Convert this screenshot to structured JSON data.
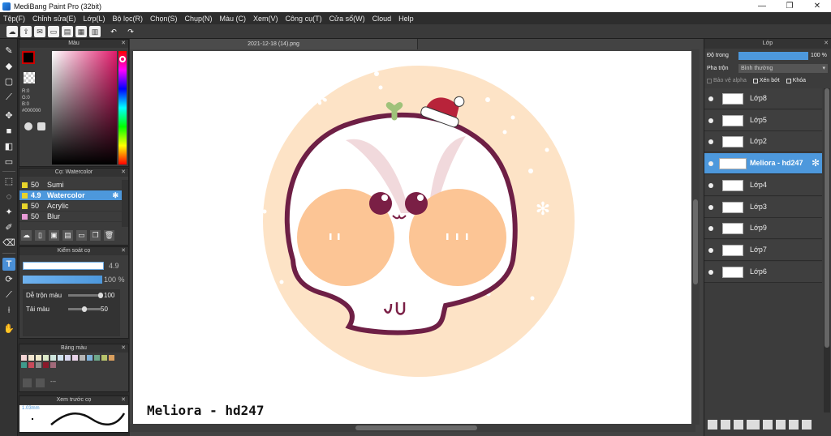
{
  "window": {
    "title": "MediBang Paint Pro (32bit)",
    "minimize": "—",
    "maximize": "❐",
    "close": "✕"
  },
  "menu": [
    "Tệp(F)",
    "Chỉnh sửa(E)",
    "Lớp(L)",
    "Bộ lọc(R)",
    "Chọn(S)",
    "Chụp(N)",
    "Màu (C)",
    "Xem(V)",
    "Công cụ(T)",
    "Cửa sổ(W)",
    "Cloud",
    "Help"
  ],
  "document": {
    "tab_title": "2021-12-18 (14).png",
    "watermark": "Meliora - hd247"
  },
  "color_panel": {
    "title": "Màu",
    "r": "R:0",
    "g": "G:0",
    "b": "B:0",
    "hex": "#000000",
    "primary": "#000000"
  },
  "brush_panel": {
    "title": "Cọ: Watercolor",
    "items": [
      {
        "size": "50",
        "name": "Sumi",
        "color": "#e8d42a"
      },
      {
        "size": "4.9",
        "name": "Watercolor",
        "color": "#e8d42a"
      },
      {
        "size": "50",
        "name": "Acrylic",
        "color": "#e8d42a"
      },
      {
        "size": "50",
        "name": "Blur",
        "color": "#e89ad6"
      }
    ],
    "selected_index": 1
  },
  "brush_control": {
    "title": "Kiểm soát cọ",
    "size": "4.9",
    "opacity": "100 %",
    "blend_label": "Dễ trộn màu",
    "blend_value": "100",
    "blend_level": 1.0,
    "resample_label": "Tải màu",
    "resample_value": "50",
    "resample_level": 0.5
  },
  "palette_panel": {
    "title": "Bảng màu",
    "dash": "---",
    "colors": [
      "#f5d6d6",
      "#f1e5cf",
      "#efe9c9",
      "#dce8c8",
      "#cfe6de",
      "#cfe1ee",
      "#d7d6ee",
      "#e8d2e8",
      "#b5b5b5",
      "#7fb1d9",
      "#6da78a",
      "#b7c36c",
      "#d99f5e",
      "#3f9a8c",
      "#c84a5a",
      "#8a8a8a",
      "#8b1a2b",
      "#a26a7a"
    ]
  },
  "preview_panel": {
    "title": "Xem trước cọ",
    "size_label": "1.03mm"
  },
  "layer_panel": {
    "title": "Lớp",
    "opacity_label": "Độ trong",
    "opacity_value": "100 %",
    "blend_label": "Pha trộn",
    "blend_value": "Bình thường",
    "protect_alpha": "Bảo vệ alpha",
    "clipping": "Xén bớt",
    "lock": "Khóa",
    "layers": [
      {
        "name": "Lớp8"
      },
      {
        "name": "Lớp5"
      },
      {
        "name": "Lớp2"
      },
      {
        "name": "Meliora - hd247"
      },
      {
        "name": "Lớp4"
      },
      {
        "name": "Lớp3"
      },
      {
        "name": "Lớp9"
      },
      {
        "name": "Lớp7"
      },
      {
        "name": "Lớp6"
      }
    ],
    "selected_index": 3
  },
  "colors": {
    "accent": "#4d98dc",
    "circle_bg": "#fde3c6",
    "blush": "#fcc595",
    "outline": "#6e1f45"
  }
}
